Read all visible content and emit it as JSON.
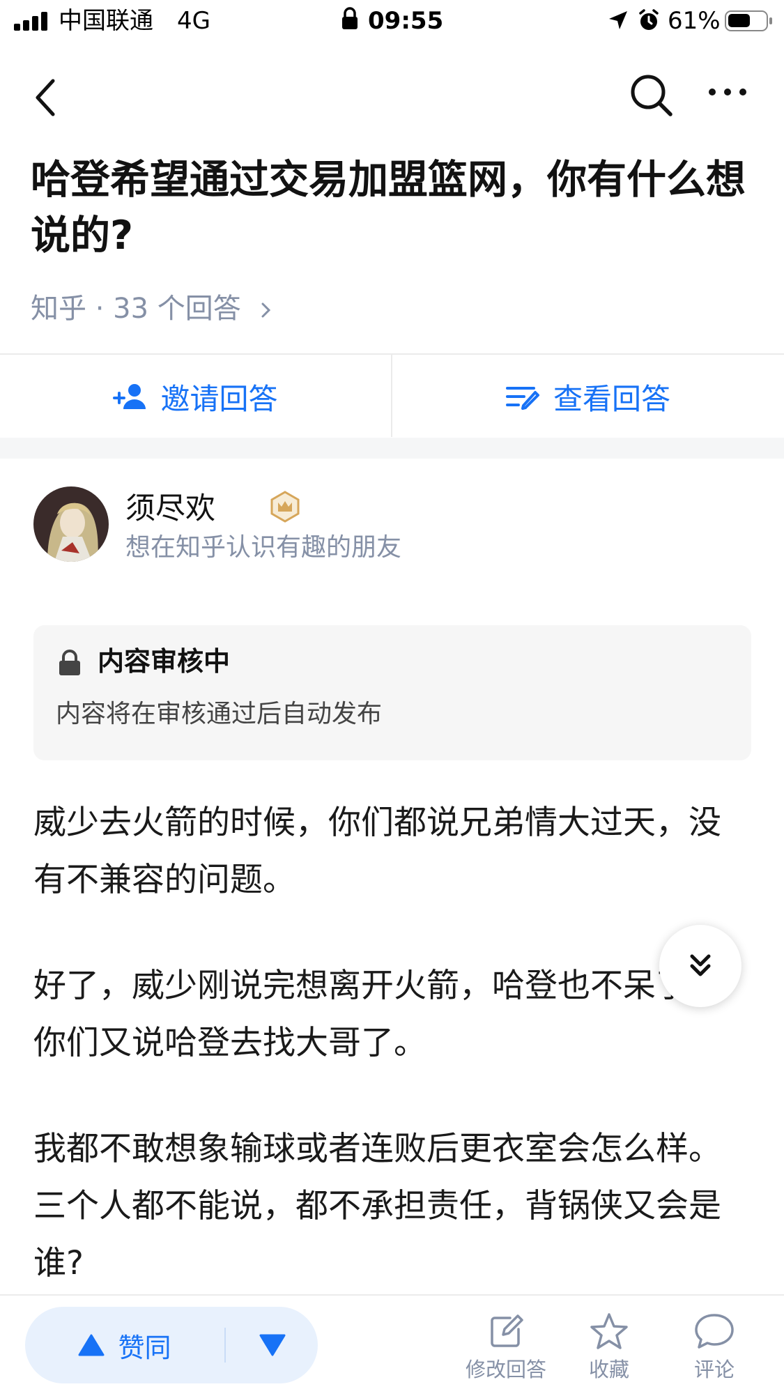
{
  "status_bar": {
    "carrier": "中国联通",
    "network": "4G",
    "time": "09:55",
    "battery": "61%",
    "battery_level": 0.61
  },
  "nav": {
    "back_icon": "back-chevron-icon",
    "search_icon": "search-icon",
    "more_icon": "more-dots-icon"
  },
  "question": {
    "title": "哈登希望通过交易加盟篮网，你有什么想说的?",
    "meta": "知乎 · 33 个回答"
  },
  "actions": {
    "invite_label": "邀请回答",
    "view_label": "查看回答"
  },
  "author": {
    "name": "须尽欢",
    "bio": "想在知乎认识有趣的朋友"
  },
  "review": {
    "title": "内容审核中",
    "description": "内容将在审核通过后自动发布"
  },
  "answer": {
    "paragraphs": [
      "威少去火箭的时候，你们都说兄弟情大过天，没有不兼容的问题。",
      "好了，威少刚说完想离开火箭，哈登也不呆了，你们又说哈登去找大哥了。",
      "我都不敢想象输球或者连败后更衣室会怎么样。三个人都不能说，都不承担责任，背锅侠又会是谁?"
    ]
  },
  "bottom_bar": {
    "upvote_label": "赞同",
    "edit_label": "修改回答",
    "favorite_label": "收藏",
    "comment_label": "评论"
  },
  "colors": {
    "accent": "#1772f6",
    "muted": "#8590a6",
    "badge_gold": "#d6a65a"
  }
}
